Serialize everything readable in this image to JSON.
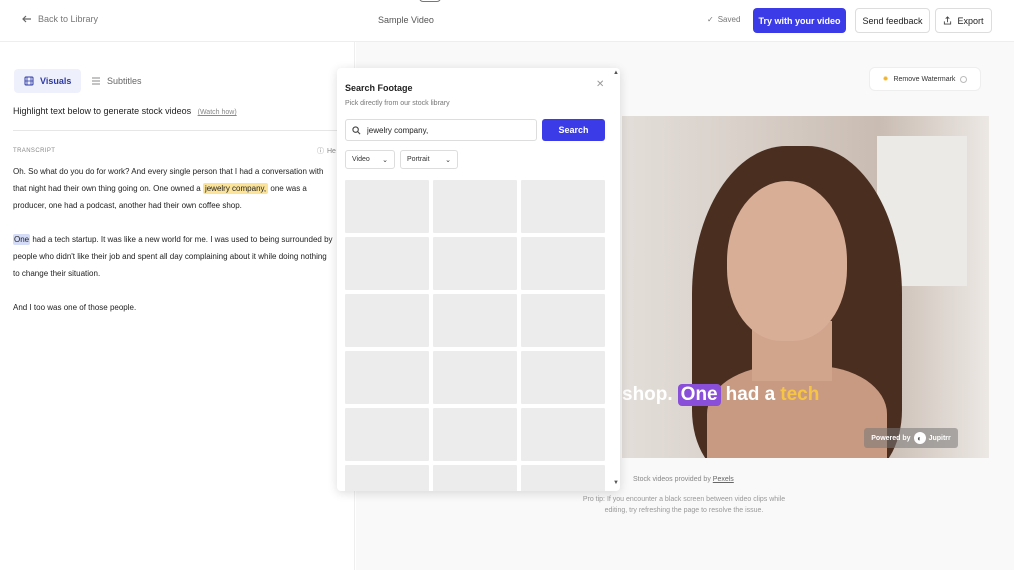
{
  "header": {
    "back_label": "Back to Library",
    "title": "Sample Video",
    "saved_label": "Saved",
    "primary_button": "Try with your video",
    "feedback_button": "Send feedback",
    "export_button": "Export"
  },
  "left": {
    "tabs": [
      {
        "label": "Visuals",
        "active": true
      },
      {
        "label": "Subtitles",
        "active": false
      }
    ],
    "hint": "Highlight text below to generate stock videos",
    "watch_link": "(Watch how)",
    "section_label": "TRANSCRIPT",
    "help_label": "He",
    "paragraphs": [
      {
        "before": "Oh. So what do you do for work? And every single person that I had a conversation with that night had their own thing going on. One owned a",
        "highlight": "jewelry company,",
        "after": "one was a producer, one had a podcast, another had their own coffee shop."
      },
      {
        "highlight": "One",
        "after": "had a tech startup. It was like a new world for me. I was used to being surrounded by people who didn't like their job and spent all day complaining about it while doing nothing to change their situation."
      },
      {
        "text": "And I too was one of those people."
      }
    ]
  },
  "search_panel": {
    "title": "Search Footage",
    "subtitle": "Pick directly from our stock library",
    "query": "jewelry company,",
    "search_button": "Search",
    "filter_type": "Video",
    "filter_orientation": "Portrait"
  },
  "preview": {
    "remove_watermark_label": "Remove Watermark",
    "caption_before": "shop.",
    "caption_highlight": "One",
    "caption_middle": "had a",
    "caption_accent": "tech",
    "powered_by": "Powered by",
    "brand": "Jupitrr",
    "credit_prefix": "Stock videos provided by",
    "credit_link": "Pexels",
    "pro_tip": "Pro tip: If you encounter a black screen between video clips while editing, try refreshing the page to resolve the issue."
  },
  "colors": {
    "accent": "#3b3be8",
    "highlight_yellow": "#fbe39a",
    "highlight_blue": "#d4dcf7",
    "caption_highlight": "#8a4fd8",
    "caption_accent": "#f6c545"
  },
  "icons": [
    "arrow-left-icon",
    "check-icon",
    "share-icon",
    "film-icon",
    "list-icon",
    "help-icon",
    "sparkle-icon",
    "close-icon",
    "search-icon",
    "chevron-down-icon",
    "jupitrr-logo-icon"
  ]
}
